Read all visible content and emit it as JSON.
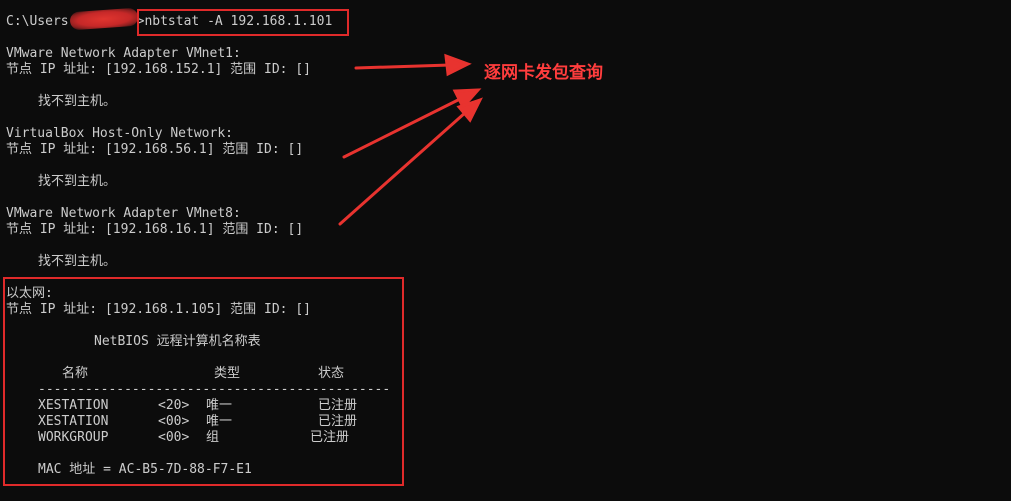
{
  "terminal": {
    "prompt_prefix": "C:\\Users",
    "prompt_suffix": ">",
    "command": "nbtstat -A 192.168.1.101",
    "adapters": [
      {
        "name": "VMware Network Adapter VMnet1:",
        "node_ip": "节点 IP 址址: [192.168.152.1] 范围 ID: []",
        "message": "找不到主机。"
      },
      {
        "name": "VirtualBox Host-Only Network:",
        "node_ip": "节点 IP 址址: [192.168.56.1] 范围 ID: []",
        "message": "找不到主机。"
      },
      {
        "name": "VMware Network Adapter VMnet8:",
        "node_ip": "节点 IP 址址: [192.168.16.1] 范围 ID: []",
        "message": "找不到主机。"
      }
    ],
    "ethernet": {
      "name": "以太网:",
      "node_ip": "节点 IP 址址: [192.168.1.105] 范围 ID: []",
      "table_title": "NetBIOS 远程计算机名称表",
      "headers": {
        "name": "名称",
        "type": "类型",
        "status": "状态"
      },
      "separator": "---------------------------------------------",
      "rows": [
        {
          "name": "XESTATION",
          "code": "<20>",
          "type": "唯一",
          "status": "已注册"
        },
        {
          "name": "XESTATION",
          "code": "<00>",
          "type": "唯一",
          "status": "已注册"
        },
        {
          "name": "WORKGROUP",
          "code": "<00>",
          "type": "组",
          "status": "已注册"
        }
      ],
      "mac": "MAC 地址 = AC-B5-7D-88-F7-E1"
    }
  },
  "annotation": {
    "text": "逐网卡发包查询",
    "color": "#ff3d3d"
  },
  "colors": {
    "background": "#0c0c0c",
    "text": "#cccccc",
    "highlight_box": "#e02a2a"
  }
}
